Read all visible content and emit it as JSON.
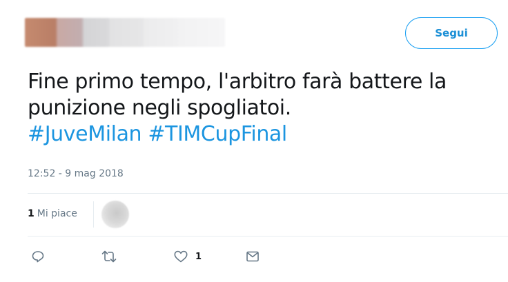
{
  "header": {
    "follow_label": "Segui"
  },
  "tweet": {
    "line1": "Fine primo tempo, l'arbitro farà battere la",
    "line2": "punizione negli spogliatoi.",
    "hashtag1": "#JuveMilan",
    "hashtag2": "#TIMCupFinal",
    "timestamp": "12:52 - 9 mag 2018"
  },
  "stats": {
    "likes_count": "1",
    "likes_label": "Mi piace"
  },
  "actions": {
    "reply_icon": "reply-icon",
    "retweet_icon": "retweet-icon",
    "like_icon": "heart-icon",
    "like_count": "1",
    "dm_icon": "envelope-icon"
  },
  "colors": {
    "accent": "#1da1f2",
    "hashtag": "#1b95e0",
    "muted": "#657786",
    "divider": "#e6ecf0"
  }
}
